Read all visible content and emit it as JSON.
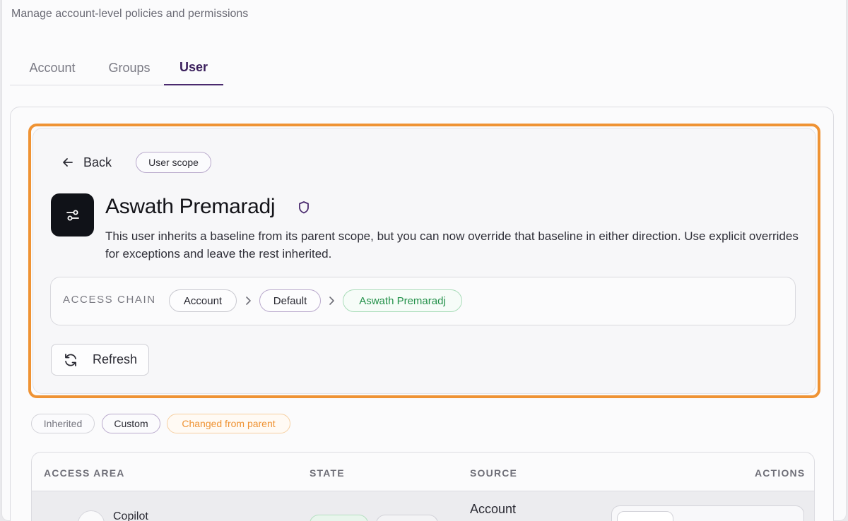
{
  "header": {
    "subtitle": "Manage account-level policies and permissions"
  },
  "tabs": [
    {
      "label": "Account",
      "active": false
    },
    {
      "label": "Groups",
      "active": false
    },
    {
      "label": "User",
      "active": true
    }
  ],
  "detail": {
    "back_label": "Back",
    "scope_badge": "User scope",
    "user_name": "Aswath Premaradj",
    "description": "This user inherits a baseline from its parent scope, but you can now override that baseline in either direction. Use explicit overrides for exceptions and leave the rest inherited.",
    "access_chain": {
      "label": "ACCESS CHAIN",
      "items": [
        "Account",
        "Default",
        "Aswath Premaradj"
      ]
    },
    "refresh_label": "Refresh"
  },
  "legend": [
    "Inherited",
    "Custom",
    "Changed from parent"
  ],
  "table": {
    "columns": [
      "ACCESS AREA",
      "STATE",
      "SOURCE",
      "ACTIONS"
    ],
    "rows": [
      {
        "area": "Copilot",
        "source": "Account"
      }
    ]
  },
  "colors": {
    "accent_purple": "#4a2a6e",
    "highlight_orange": "#ef9334",
    "inherit_green": "#23914a"
  },
  "icons": {
    "back": "arrow-left-icon",
    "avatar": "sliders-icon",
    "badge": "shield-icon",
    "chain_separator": "chevron-right-icon",
    "refresh": "refresh-icon"
  }
}
